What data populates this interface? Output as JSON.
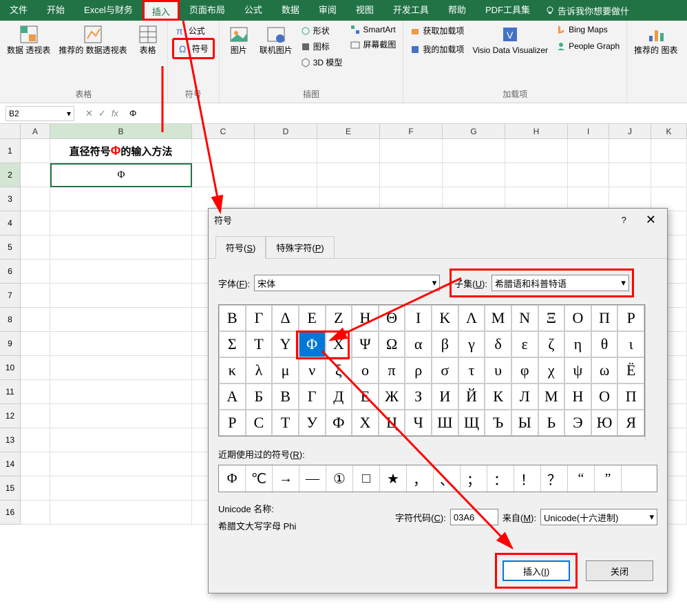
{
  "ribbon": {
    "tabs": [
      "文件",
      "开始",
      "Excel与财务",
      "插入",
      "页面布局",
      "公式",
      "数据",
      "审阅",
      "视图",
      "开发工具",
      "帮助",
      "PDF工具集"
    ],
    "active_tab": "插入",
    "tell_me": "告诉我你想要做什"
  },
  "groups": {
    "tables": {
      "pivot": "数据\n透视表",
      "recommended": "推荐的\n数据透视表",
      "table": "表格",
      "label": "表格"
    },
    "symbols": {
      "formula": "公式",
      "symbol": "符号",
      "label": "符号"
    },
    "illustrations": {
      "pictures": "图片",
      "online": "联机图片",
      "shapes": "形状",
      "icons": "图标",
      "model": "3D 模型",
      "smartart": "SmartArt",
      "screenshot": "屏幕截图",
      "label": "插图"
    },
    "addins": {
      "get": "获取加载项",
      "my": "我的加载项",
      "visio": "Visio Data\nVisualizer",
      "bing": "Bing Maps",
      "people": "People Graph",
      "label": "加载项"
    },
    "charts": {
      "recommended": "推荐的\n图表"
    }
  },
  "formula_bar": {
    "name": "B2",
    "value": "Φ"
  },
  "columns": [
    "A",
    "B",
    "C",
    "D",
    "E",
    "F",
    "G",
    "H",
    "I",
    "J",
    "K"
  ],
  "rows": [
    "1",
    "2",
    "3",
    "4",
    "5",
    "6",
    "7",
    "8",
    "9",
    "10",
    "11",
    "12",
    "13",
    "14",
    "15",
    "16"
  ],
  "cells": {
    "B1_pre": "直径符号",
    "B1_phi": "Φ",
    "B1_post": "的输入方法",
    "B2": "Φ"
  },
  "dialog": {
    "title": "符号",
    "help": "?",
    "tab1": "符号(S)",
    "tab2": "特殊字符(P)",
    "font_label": "字体(F):",
    "font_value": "宋体",
    "subset_label": "子集(U):",
    "subset_value": "希腊语和科普特语",
    "grid": [
      [
        "Β",
        "Γ",
        "Δ",
        "Ε",
        "Ζ",
        "Η",
        "Θ",
        "Ι",
        "Κ",
        "Λ",
        "Μ",
        "Ν",
        "Ξ",
        "Ο",
        "Π",
        "Ρ"
      ],
      [
        "Σ",
        "Τ",
        "Υ",
        "Φ",
        "Χ",
        "Ψ",
        "Ω",
        "α",
        "β",
        "γ",
        "δ",
        "ε",
        "ζ",
        "η",
        "θ",
        "ι"
      ],
      [
        "κ",
        "λ",
        "μ",
        "ν",
        "ξ",
        "ο",
        "π",
        "ρ",
        "σ",
        "τ",
        "υ",
        "φ",
        "χ",
        "ψ",
        "ω",
        "Ё"
      ],
      [
        "А",
        "Б",
        "В",
        "Г",
        "Д",
        "Е",
        "Ж",
        "З",
        "И",
        "Й",
        "К",
        "Л",
        "М",
        "Н",
        "О",
        "П"
      ],
      [
        "Р",
        "С",
        "Т",
        "У",
        "Ф",
        "Х",
        "Ц",
        "Ч",
        "Ш",
        "Щ",
        "Ъ",
        "Ы",
        "Ь",
        "Э",
        "Ю",
        "Я"
      ]
    ],
    "selected_row": 1,
    "selected_col": 3,
    "recent_label": "近期使用过的符号(R):",
    "recent": [
      "Φ",
      "℃",
      "→",
      "—",
      "①",
      "□",
      "★",
      "，",
      "、",
      "；",
      "：",
      "！",
      "？",
      "“",
      "”"
    ],
    "unicode_name_label": "Unicode 名称:",
    "unicode_name": "希腊文大写字母 Phi",
    "charcode_label": "字符代码(C):",
    "charcode": "03A6",
    "from_label": "来自(M):",
    "from_value": "Unicode(十六进制)",
    "insert_btn": "插入(I)",
    "close_btn": "关闭"
  }
}
